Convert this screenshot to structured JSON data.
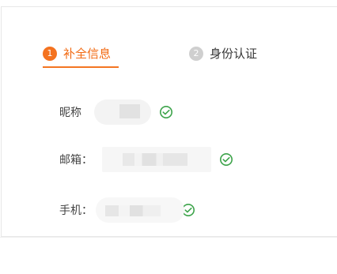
{
  "steps": [
    {
      "number": "1",
      "label": "补全信息"
    },
    {
      "number": "2",
      "label": "身份认证"
    }
  ],
  "form": {
    "nickname_label": "昵称",
    "email_label": "邮箱：",
    "phone_label": "手机："
  },
  "colors": {
    "accent": "#f26a12",
    "success": "#3ca34a"
  },
  "icons": {
    "verified": "check-circle-icon"
  }
}
